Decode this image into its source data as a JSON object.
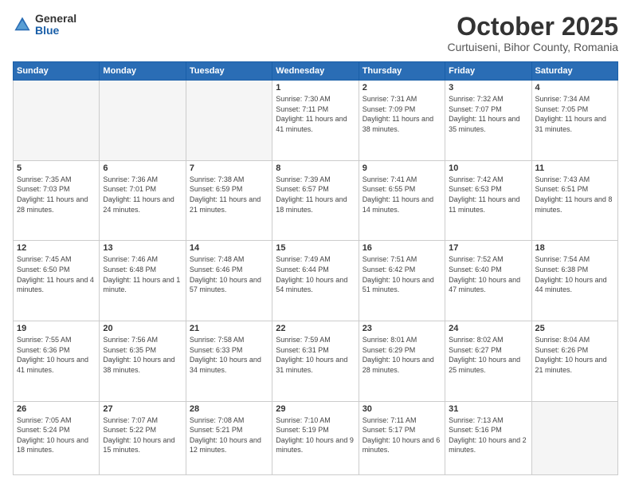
{
  "logo": {
    "general": "General",
    "blue": "Blue"
  },
  "header": {
    "title": "October 2025",
    "subtitle": "Curtuiseni, Bihor County, Romania"
  },
  "weekdays": [
    "Sunday",
    "Monday",
    "Tuesday",
    "Wednesday",
    "Thursday",
    "Friday",
    "Saturday"
  ],
  "weeks": [
    [
      {
        "day": "",
        "sunrise": "",
        "sunset": "",
        "daylight": ""
      },
      {
        "day": "",
        "sunrise": "",
        "sunset": "",
        "daylight": ""
      },
      {
        "day": "",
        "sunrise": "",
        "sunset": "",
        "daylight": ""
      },
      {
        "day": "1",
        "sunrise": "Sunrise: 7:30 AM",
        "sunset": "Sunset: 7:11 PM",
        "daylight": "Daylight: 11 hours and 41 minutes."
      },
      {
        "day": "2",
        "sunrise": "Sunrise: 7:31 AM",
        "sunset": "Sunset: 7:09 PM",
        "daylight": "Daylight: 11 hours and 38 minutes."
      },
      {
        "day": "3",
        "sunrise": "Sunrise: 7:32 AM",
        "sunset": "Sunset: 7:07 PM",
        "daylight": "Daylight: 11 hours and 35 minutes."
      },
      {
        "day": "4",
        "sunrise": "Sunrise: 7:34 AM",
        "sunset": "Sunset: 7:05 PM",
        "daylight": "Daylight: 11 hours and 31 minutes."
      }
    ],
    [
      {
        "day": "5",
        "sunrise": "Sunrise: 7:35 AM",
        "sunset": "Sunset: 7:03 PM",
        "daylight": "Daylight: 11 hours and 28 minutes."
      },
      {
        "day": "6",
        "sunrise": "Sunrise: 7:36 AM",
        "sunset": "Sunset: 7:01 PM",
        "daylight": "Daylight: 11 hours and 24 minutes."
      },
      {
        "day": "7",
        "sunrise": "Sunrise: 7:38 AM",
        "sunset": "Sunset: 6:59 PM",
        "daylight": "Daylight: 11 hours and 21 minutes."
      },
      {
        "day": "8",
        "sunrise": "Sunrise: 7:39 AM",
        "sunset": "Sunset: 6:57 PM",
        "daylight": "Daylight: 11 hours and 18 minutes."
      },
      {
        "day": "9",
        "sunrise": "Sunrise: 7:41 AM",
        "sunset": "Sunset: 6:55 PM",
        "daylight": "Daylight: 11 hours and 14 minutes."
      },
      {
        "day": "10",
        "sunrise": "Sunrise: 7:42 AM",
        "sunset": "Sunset: 6:53 PM",
        "daylight": "Daylight: 11 hours and 11 minutes."
      },
      {
        "day": "11",
        "sunrise": "Sunrise: 7:43 AM",
        "sunset": "Sunset: 6:51 PM",
        "daylight": "Daylight: 11 hours and 8 minutes."
      }
    ],
    [
      {
        "day": "12",
        "sunrise": "Sunrise: 7:45 AM",
        "sunset": "Sunset: 6:50 PM",
        "daylight": "Daylight: 11 hours and 4 minutes."
      },
      {
        "day": "13",
        "sunrise": "Sunrise: 7:46 AM",
        "sunset": "Sunset: 6:48 PM",
        "daylight": "Daylight: 11 hours and 1 minute."
      },
      {
        "day": "14",
        "sunrise": "Sunrise: 7:48 AM",
        "sunset": "Sunset: 6:46 PM",
        "daylight": "Daylight: 10 hours and 57 minutes."
      },
      {
        "day": "15",
        "sunrise": "Sunrise: 7:49 AM",
        "sunset": "Sunset: 6:44 PM",
        "daylight": "Daylight: 10 hours and 54 minutes."
      },
      {
        "day": "16",
        "sunrise": "Sunrise: 7:51 AM",
        "sunset": "Sunset: 6:42 PM",
        "daylight": "Daylight: 10 hours and 51 minutes."
      },
      {
        "day": "17",
        "sunrise": "Sunrise: 7:52 AM",
        "sunset": "Sunset: 6:40 PM",
        "daylight": "Daylight: 10 hours and 47 minutes."
      },
      {
        "day": "18",
        "sunrise": "Sunrise: 7:54 AM",
        "sunset": "Sunset: 6:38 PM",
        "daylight": "Daylight: 10 hours and 44 minutes."
      }
    ],
    [
      {
        "day": "19",
        "sunrise": "Sunrise: 7:55 AM",
        "sunset": "Sunset: 6:36 PM",
        "daylight": "Daylight: 10 hours and 41 minutes."
      },
      {
        "day": "20",
        "sunrise": "Sunrise: 7:56 AM",
        "sunset": "Sunset: 6:35 PM",
        "daylight": "Daylight: 10 hours and 38 minutes."
      },
      {
        "day": "21",
        "sunrise": "Sunrise: 7:58 AM",
        "sunset": "Sunset: 6:33 PM",
        "daylight": "Daylight: 10 hours and 34 minutes."
      },
      {
        "day": "22",
        "sunrise": "Sunrise: 7:59 AM",
        "sunset": "Sunset: 6:31 PM",
        "daylight": "Daylight: 10 hours and 31 minutes."
      },
      {
        "day": "23",
        "sunrise": "Sunrise: 8:01 AM",
        "sunset": "Sunset: 6:29 PM",
        "daylight": "Daylight: 10 hours and 28 minutes."
      },
      {
        "day": "24",
        "sunrise": "Sunrise: 8:02 AM",
        "sunset": "Sunset: 6:27 PM",
        "daylight": "Daylight: 10 hours and 25 minutes."
      },
      {
        "day": "25",
        "sunrise": "Sunrise: 8:04 AM",
        "sunset": "Sunset: 6:26 PM",
        "daylight": "Daylight: 10 hours and 21 minutes."
      }
    ],
    [
      {
        "day": "26",
        "sunrise": "Sunrise: 7:05 AM",
        "sunset": "Sunset: 5:24 PM",
        "daylight": "Daylight: 10 hours and 18 minutes."
      },
      {
        "day": "27",
        "sunrise": "Sunrise: 7:07 AM",
        "sunset": "Sunset: 5:22 PM",
        "daylight": "Daylight: 10 hours and 15 minutes."
      },
      {
        "day": "28",
        "sunrise": "Sunrise: 7:08 AM",
        "sunset": "Sunset: 5:21 PM",
        "daylight": "Daylight: 10 hours and 12 minutes."
      },
      {
        "day": "29",
        "sunrise": "Sunrise: 7:10 AM",
        "sunset": "Sunset: 5:19 PM",
        "daylight": "Daylight: 10 hours and 9 minutes."
      },
      {
        "day": "30",
        "sunrise": "Sunrise: 7:11 AM",
        "sunset": "Sunset: 5:17 PM",
        "daylight": "Daylight: 10 hours and 6 minutes."
      },
      {
        "day": "31",
        "sunrise": "Sunrise: 7:13 AM",
        "sunset": "Sunset: 5:16 PM",
        "daylight": "Daylight: 10 hours and 2 minutes."
      },
      {
        "day": "",
        "sunrise": "",
        "sunset": "",
        "daylight": ""
      }
    ]
  ]
}
